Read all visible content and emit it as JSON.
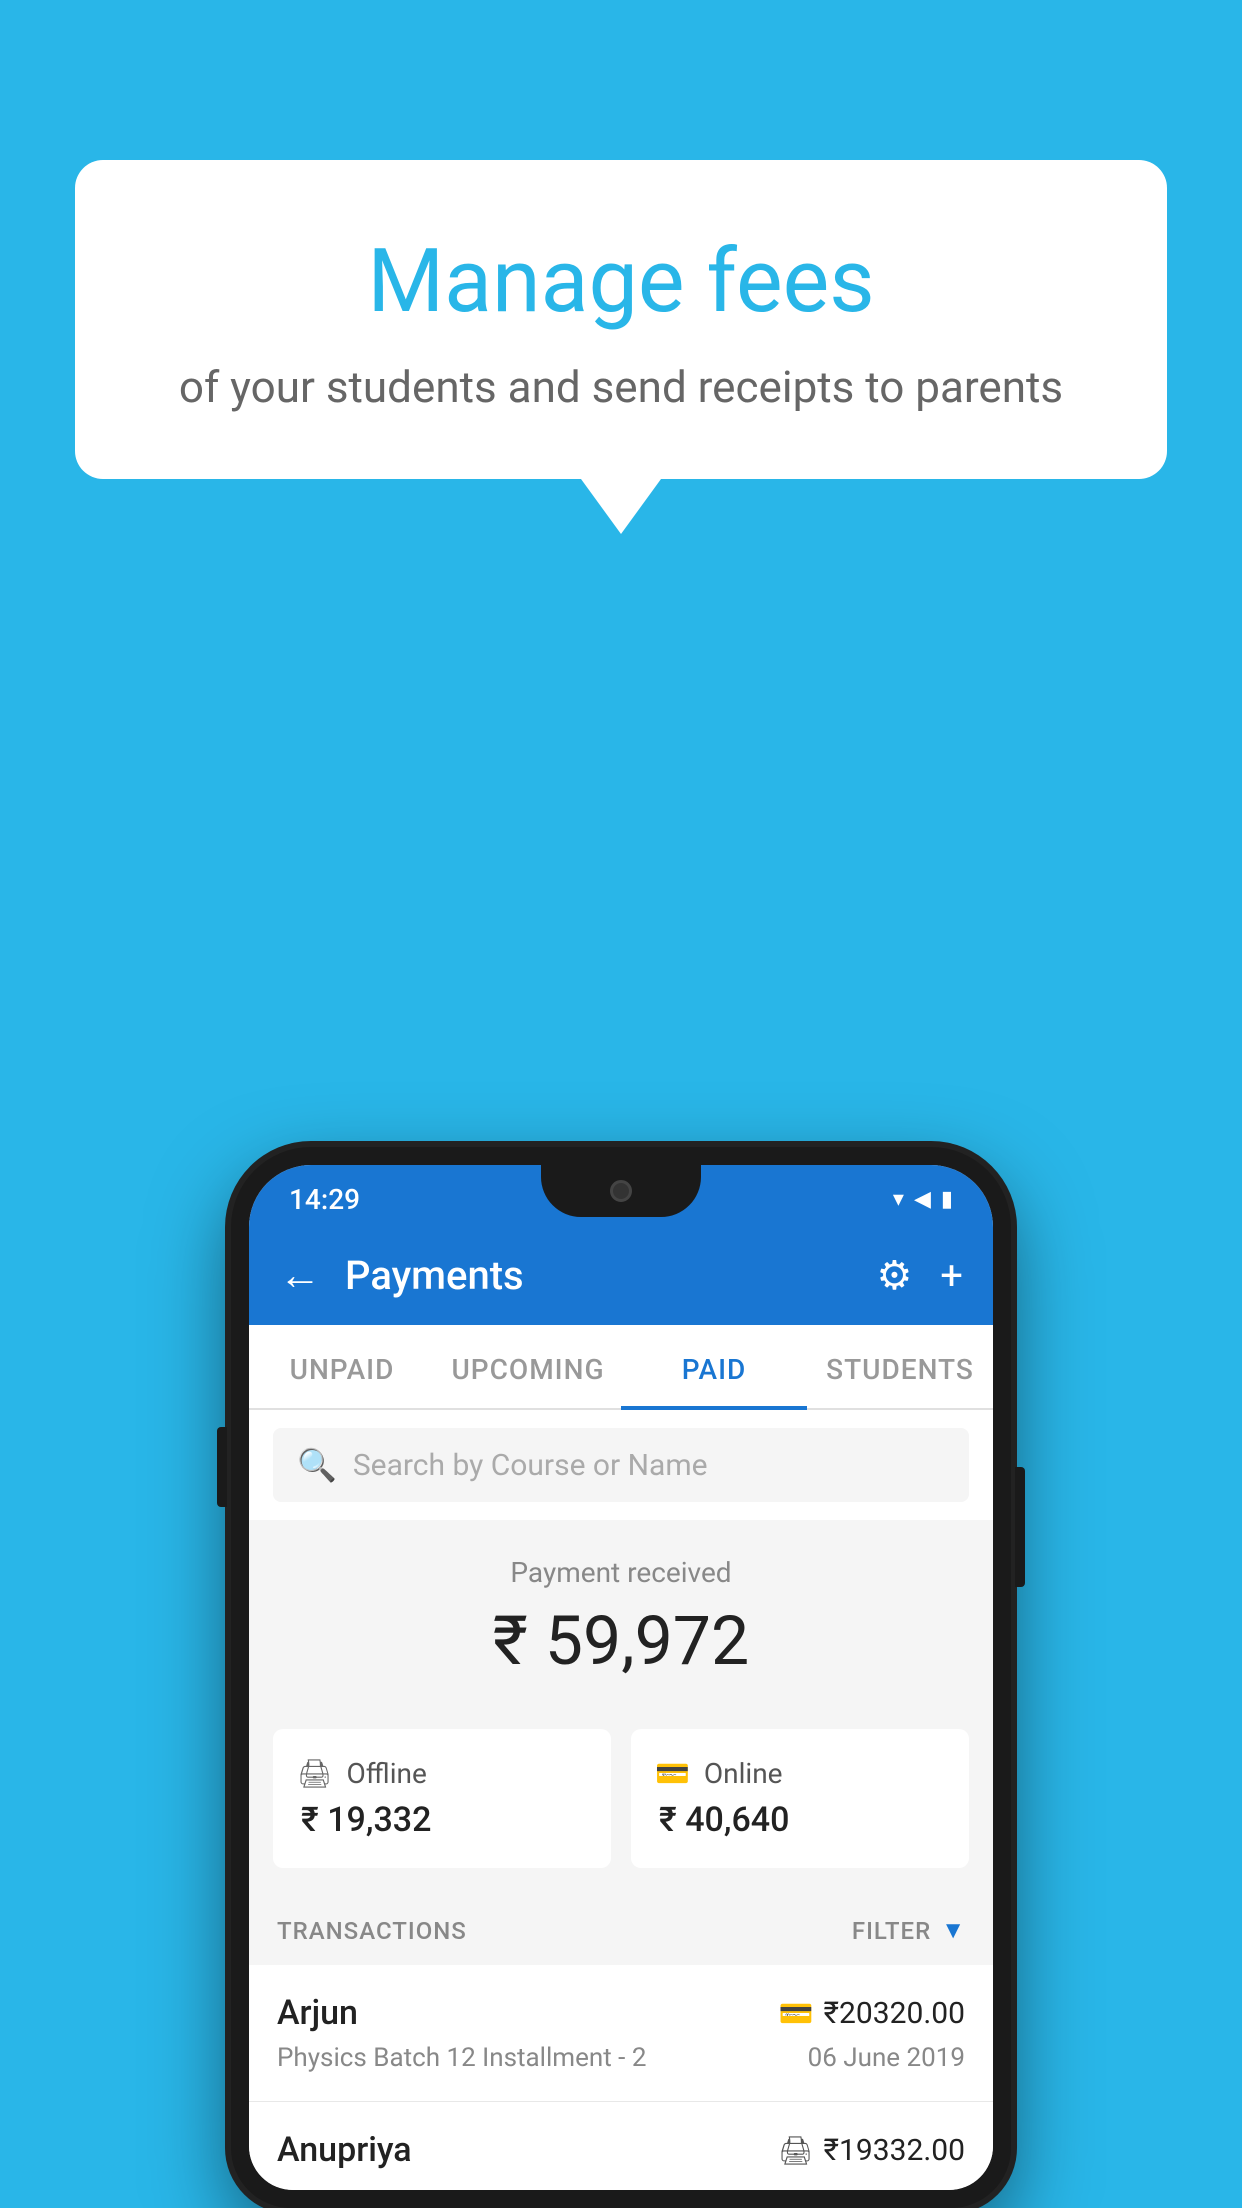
{
  "background_color": "#29b6e8",
  "speech_bubble": {
    "title": "Manage fees",
    "subtitle": "of your students and send receipts to parents"
  },
  "status_bar": {
    "time": "14:29",
    "wifi": "▾",
    "signal": "▲",
    "battery": "▮"
  },
  "app_bar": {
    "title": "Payments",
    "back_icon": "←",
    "gear_icon": "⚙",
    "plus_icon": "+"
  },
  "tabs": [
    {
      "label": "UNPAID",
      "active": false
    },
    {
      "label": "UPCOMING",
      "active": false
    },
    {
      "label": "PAID",
      "active": true
    },
    {
      "label": "STUDENTS",
      "active": false
    }
  ],
  "search": {
    "placeholder": "Search by Course or Name"
  },
  "payment_received": {
    "label": "Payment received",
    "amount": "₹ 59,972"
  },
  "payment_cards": [
    {
      "icon": "offline",
      "label": "Offline",
      "amount": "₹ 19,332"
    },
    {
      "icon": "online",
      "label": "Online",
      "amount": "₹ 40,640"
    }
  ],
  "transactions": {
    "label": "TRANSACTIONS",
    "filter_label": "FILTER",
    "items": [
      {
        "name": "Arjun",
        "amount": "₹20320.00",
        "payment_type": "card",
        "course": "Physics Batch 12 Installment - 2",
        "date": "06 June 2019"
      },
      {
        "name": "Anupriya",
        "amount": "₹19332.00",
        "payment_type": "offline",
        "course": "",
        "date": ""
      }
    ]
  }
}
